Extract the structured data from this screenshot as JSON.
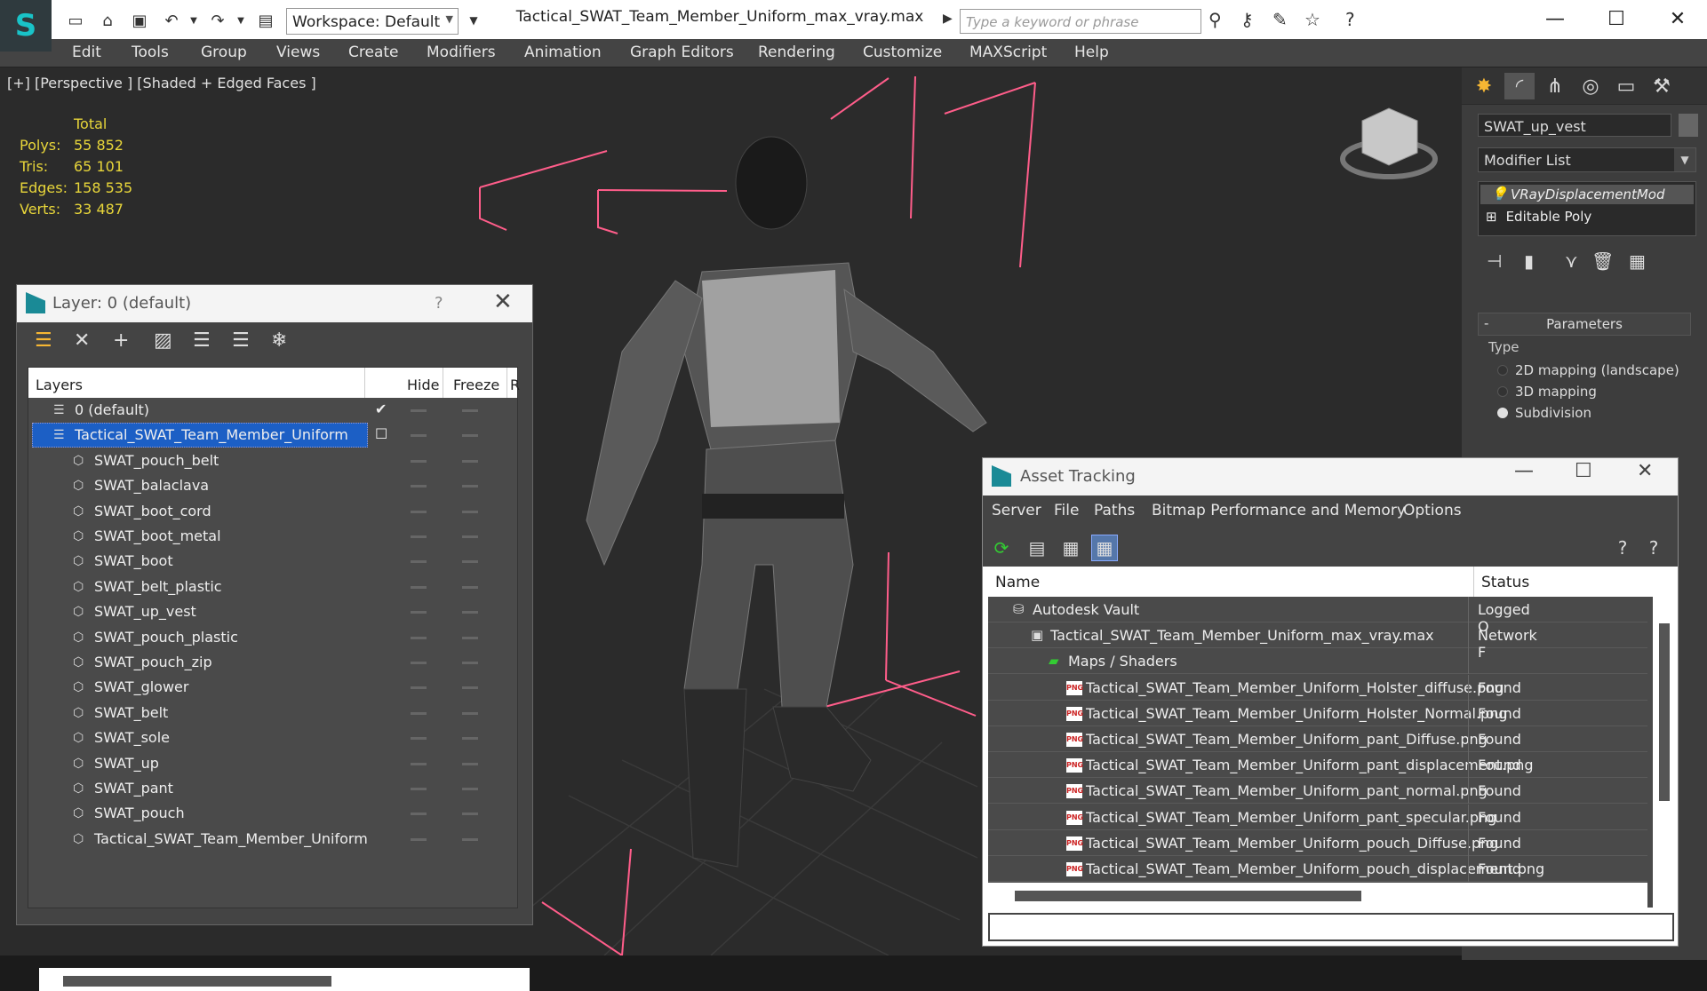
{
  "app": {
    "title": "Tactical_SWAT_Team_Member_Uniform_max_vray.max",
    "workspace": "Workspace: Default",
    "search_placeholder": "Type a keyword or phrase",
    "colors": {
      "accent": "#1c5fc5",
      "stats": "#e8d63a",
      "grid": "#ff5d8a"
    }
  },
  "menu": [
    "Edit",
    "Tools",
    "Group",
    "Views",
    "Create",
    "Modifiers",
    "Animation",
    "Graph Editors",
    "Rendering",
    "Customize",
    "MAXScript",
    "Help"
  ],
  "viewport": {
    "label": "[+] [Perspective ] [Shaded + Edged Faces ]",
    "stats_header": "Total",
    "stats": [
      {
        "k": "Polys:",
        "v": "55 852"
      },
      {
        "k": "Tris:",
        "v": "65 101"
      },
      {
        "k": "Edges:",
        "v": "158 535"
      },
      {
        "k": "Verts:",
        "v": "33 487"
      }
    ]
  },
  "command_panel": {
    "object_name": "SWAT_up_vest",
    "modifier_list": "Modifier List",
    "stack": [
      "VRayDisplacementMod",
      "Editable Poly"
    ],
    "rollout": "Parameters",
    "type_label": "Type",
    "options": [
      {
        "label": "2D mapping (landscape)",
        "selected": false
      },
      {
        "label": "3D mapping",
        "selected": false
      },
      {
        "label": "Subdivision",
        "selected": true
      }
    ]
  },
  "layer_window": {
    "title": "Layer: 0 (default)",
    "help": "?",
    "columns": {
      "layers": "Layers",
      "hide": "Hide",
      "freeze": "Freeze",
      "r": "R"
    },
    "rows": [
      {
        "name": "0 (default)",
        "level": 0
      },
      {
        "name": "Tactical_SWAT_Team_Member_Uniform",
        "level": 0,
        "selected": true
      },
      {
        "name": "SWAT_pouch_belt",
        "level": 1
      },
      {
        "name": "SWAT_balaclava",
        "level": 1
      },
      {
        "name": "SWAT_boot_cord",
        "level": 1
      },
      {
        "name": "SWAT_boot_metal",
        "level": 1
      },
      {
        "name": "SWAT_boot",
        "level": 1
      },
      {
        "name": "SWAT_belt_plastic",
        "level": 1
      },
      {
        "name": "SWAT_up_vest",
        "level": 1
      },
      {
        "name": "SWAT_pouch_plastic",
        "level": 1
      },
      {
        "name": "SWAT_pouch_zip",
        "level": 1
      },
      {
        "name": "SWAT_glower",
        "level": 1
      },
      {
        "name": "SWAT_belt",
        "level": 1
      },
      {
        "name": "SWAT_sole",
        "level": 1
      },
      {
        "name": "SWAT_up",
        "level": 1
      },
      {
        "name": "SWAT_pant",
        "level": 1
      },
      {
        "name": "SWAT_pouch",
        "level": 1
      },
      {
        "name": "Tactical_SWAT_Team_Member_Uniform",
        "level": 1
      }
    ]
  },
  "asset_window": {
    "title": "Asset Tracking",
    "menu": [
      "Server",
      "File",
      "Paths",
      "Bitmap Performance and Memory",
      "Options"
    ],
    "columns": {
      "name": "Name",
      "status": "Status"
    },
    "rows": [
      {
        "name": "Autodesk Vault",
        "status": "Logged O",
        "level": 0,
        "icon": "vault"
      },
      {
        "name": "Tactical_SWAT_Team_Member_Uniform_max_vray.max",
        "status": "Network F",
        "level": 1,
        "icon": "max"
      },
      {
        "name": "Maps / Shaders",
        "status": "",
        "level": 2,
        "icon": "maps"
      },
      {
        "name": "Tactical_SWAT_Team_Member_Uniform_Holster_diffuse.png",
        "status": "Found",
        "level": 3,
        "icon": "png"
      },
      {
        "name": "Tactical_SWAT_Team_Member_Uniform_Holster_Normal.png",
        "status": "Found",
        "level": 3,
        "icon": "png"
      },
      {
        "name": "Tactical_SWAT_Team_Member_Uniform_pant_Diffuse.png",
        "status": "Found",
        "level": 3,
        "icon": "png"
      },
      {
        "name": "Tactical_SWAT_Team_Member_Uniform_pant_displacement.png",
        "status": "Found",
        "level": 3,
        "icon": "png"
      },
      {
        "name": "Tactical_SWAT_Team_Member_Uniform_pant_normal.png",
        "status": "Found",
        "level": 3,
        "icon": "png"
      },
      {
        "name": "Tactical_SWAT_Team_Member_Uniform_pant_specular.png",
        "status": "Found",
        "level": 3,
        "icon": "png"
      },
      {
        "name": "Tactical_SWAT_Team_Member_Uniform_pouch_Diffuse.png",
        "status": "Found",
        "level": 3,
        "icon": "png"
      },
      {
        "name": "Tactical_SWAT_Team_Member_Uniform_pouch_displacement.png",
        "status": "Found",
        "level": 3,
        "icon": "png"
      }
    ]
  }
}
